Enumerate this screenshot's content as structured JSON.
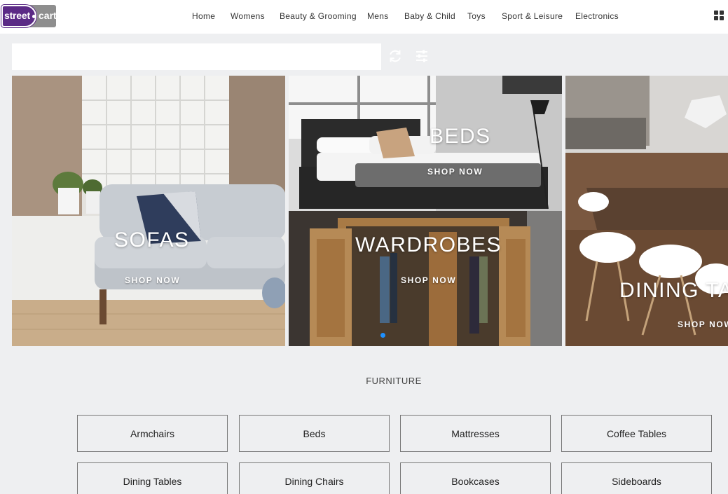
{
  "brand": {
    "part1": "street",
    "part2": "cart"
  },
  "nav": [
    "Home",
    "Womens",
    "Beauty & Grooming",
    "Mens",
    "Baby & Child",
    "Toys",
    "Sport & Leisure",
    "Electronics"
  ],
  "search": {
    "value": "",
    "placeholder": ""
  },
  "banners": {
    "sofas": {
      "title": "SOFAS",
      "cta": "SHOP NOW"
    },
    "beds": {
      "title": "BEDS",
      "cta": "SHOP NOW"
    },
    "wardrobes": {
      "title": "WARDROBES",
      "cta": "SHOP NOW"
    },
    "dining": {
      "title": "DINING TA",
      "cta": "SHOP NOW"
    }
  },
  "section": {
    "title": "FURNITURE"
  },
  "categories": [
    "Armchairs",
    "Beds",
    "Mattresses",
    "Coffee Tables",
    "Dining Tables",
    "Dining Chairs",
    "Bookcases",
    "Sideboards"
  ],
  "colors": {
    "brand_purple": "#5b2a86",
    "brand_grey": "#8e8e8e",
    "carousel_dot": "#1e90ff",
    "background": "#eeeff1"
  }
}
